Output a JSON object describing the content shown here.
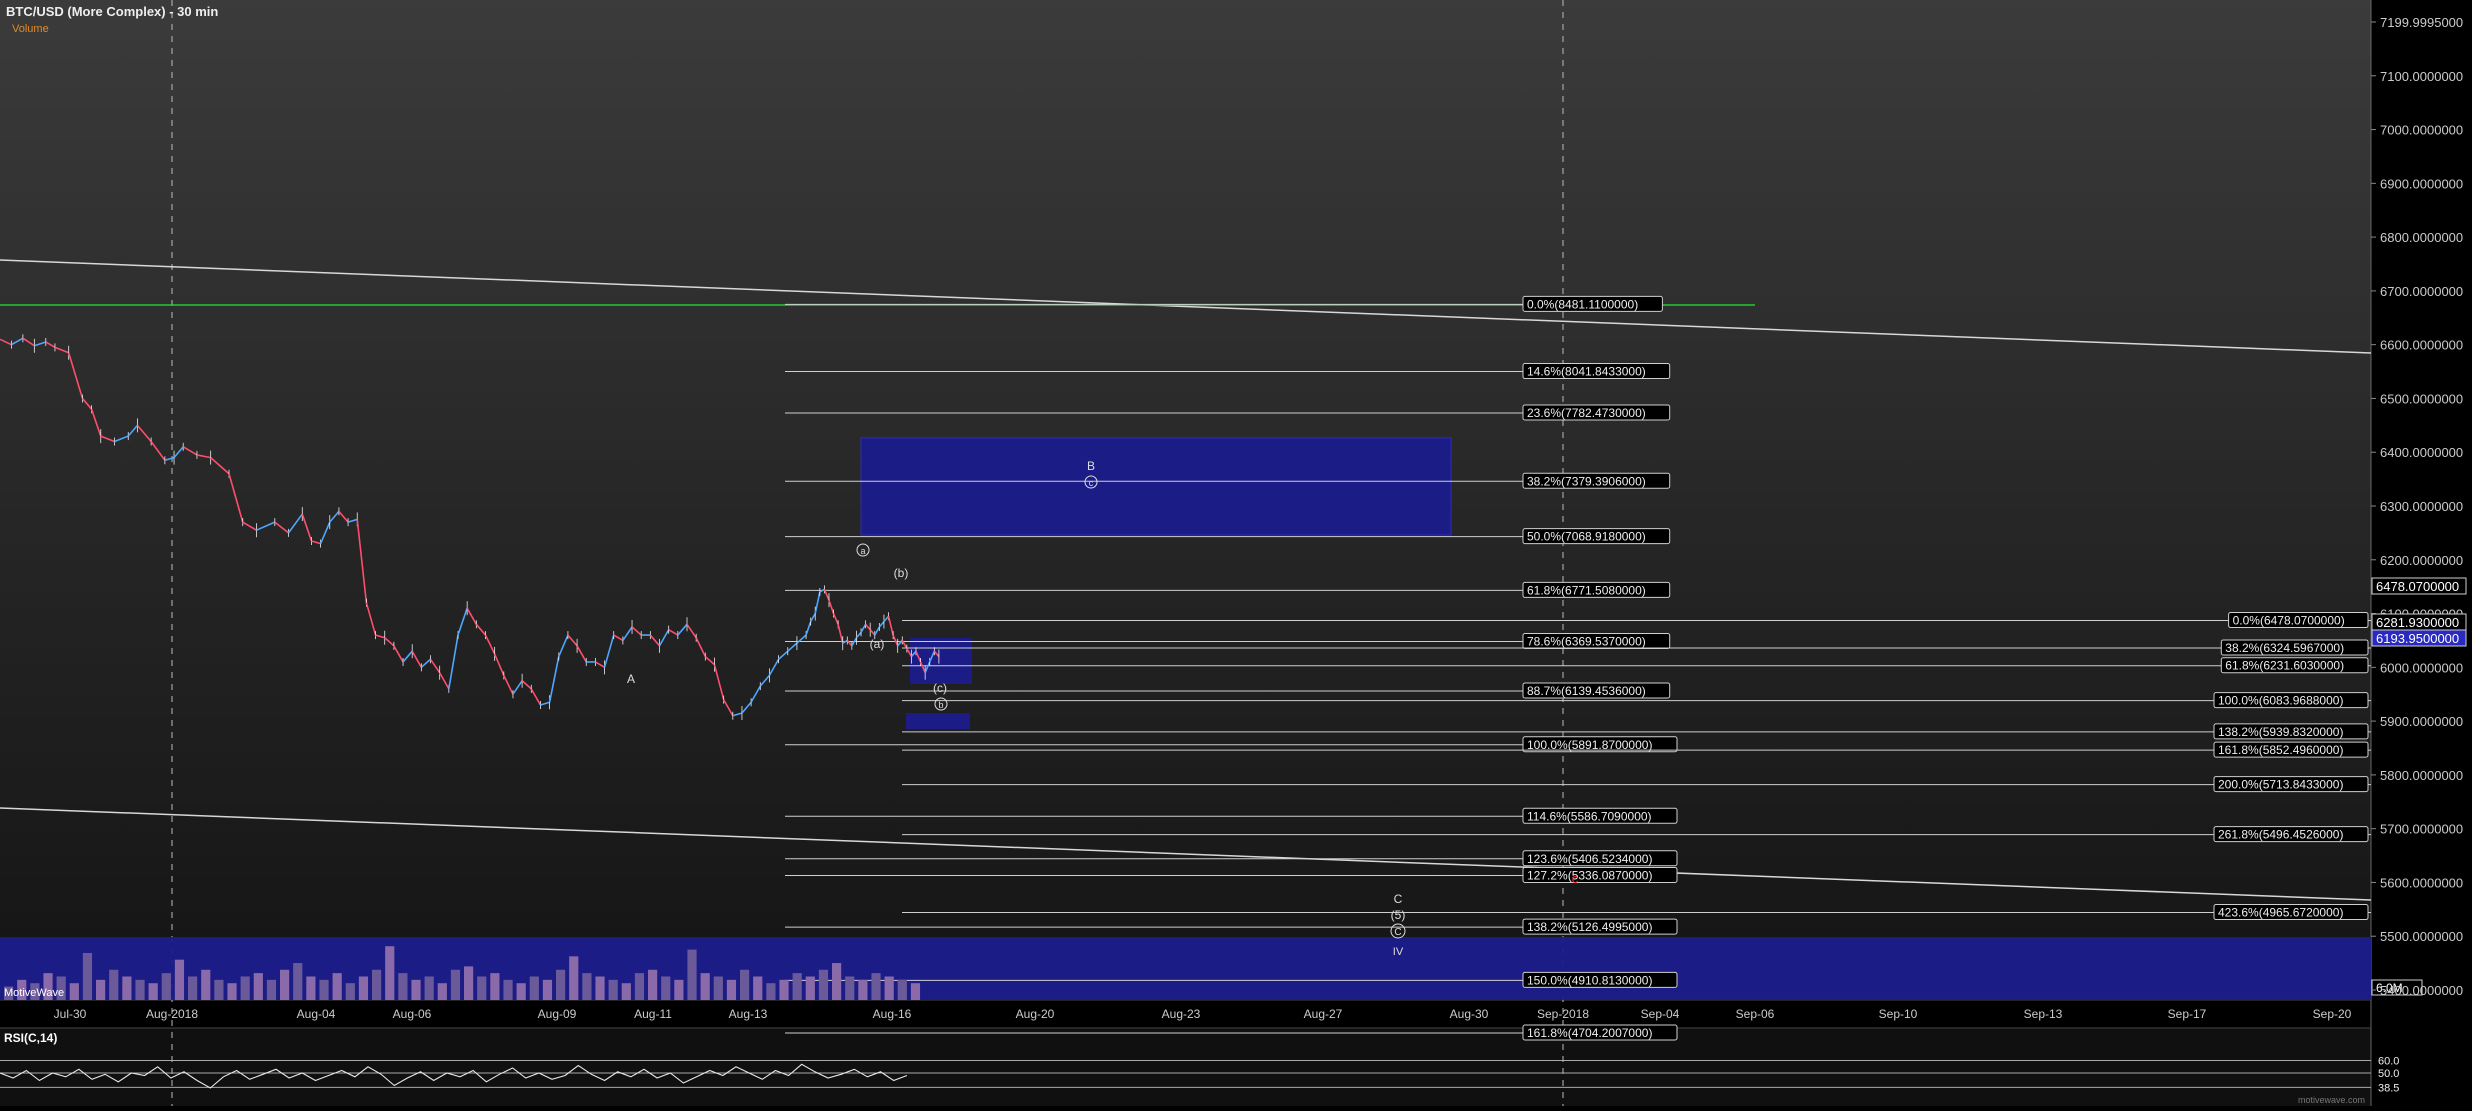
{
  "header": {
    "title": "BTC/USD (More Complex) - 30 min",
    "volume_label": "Volume",
    "rsi_label": "RSI(C,14)",
    "watermark": "MotiveWave",
    "credit": "motivewave.com"
  },
  "colors": {
    "background": "#000000",
    "up_candle": "#4da6ff",
    "down_candle": "#ff4d6d",
    "box_fill": "#1c1c8c",
    "green_line": "#22cc33",
    "wave_c_red": "#ff2222",
    "axis_text": "#cccccc"
  },
  "chart_data": [
    {
      "type": "line",
      "title": "BTC/USD (More Complex) - 30 min",
      "x_tick_labels": [
        "Jul-30",
        "Aug-2018",
        "Aug-04",
        "Aug-06",
        "Aug-09",
        "Aug-11",
        "Aug-13",
        "Aug-16",
        "Aug-20",
        "Aug-23",
        "Aug-27",
        "Aug-30",
        "Sep-2018",
        "Sep-04",
        "Sep-06",
        "Sep-10",
        "Sep-13",
        "Sep-17",
        "Sep-20"
      ],
      "y_tick_labels": [
        "7199.9995000",
        "7100.0000000",
        "7000.0000000",
        "6900.0000000",
        "6800.0000000",
        "6700.0000000",
        "6600.0000000",
        "6500.0000000",
        "6400.0000000",
        "6300.0000000",
        "6200.0000000",
        "6100.0000000",
        "6000.0000000",
        "5900.0000000",
        "5800.0000000",
        "5700.0000000",
        "5600.0000000",
        "5500.0000000",
        "5400.0000000"
      ],
      "ylim": [
        5380,
        7200
      ],
      "grid": false,
      "price_path": {
        "days": [
          0,
          0.25,
          0.5,
          0.75,
          1,
          1.2,
          1.5,
          1.8,
          2,
          2.2,
          2.5,
          2.8,
          3,
          3.3,
          3.6,
          3.8,
          4,
          4.3,
          4.6,
          5,
          5.3,
          5.6,
          6,
          6.3,
          6.6,
          6.8,
          7,
          7.2,
          7.4,
          7.6,
          7.8,
          8,
          8.2,
          8.4,
          8.6,
          8.8,
          9,
          9.2,
          9.4,
          9.6,
          9.8,
          10,
          10.2,
          10.4,
          10.6,
          10.8,
          11,
          11.2,
          11.4,
          11.6,
          11.8,
          12,
          12.2,
          12.4,
          12.6,
          12.8,
          13,
          13.2,
          13.4,
          13.6,
          13.8,
          14,
          14.2,
          14.4,
          14.6,
          14.8,
          15,
          15.2,
          15.4,
          15.6,
          15.8,
          16,
          16.2,
          16.4,
          16.6,
          16.8,
          17,
          17.2,
          17.4,
          17.6,
          17.7,
          17.8,
          17.9,
          18,
          18.1,
          18.2,
          18.3,
          18.4,
          18.5,
          18.6,
          18.7,
          18.8,
          18.9,
          19,
          19.1,
          19.2,
          19.3,
          19.4,
          19.5,
          19.6,
          19.7,
          19.8,
          19.9,
          20,
          20.1,
          20.2,
          20.3,
          20.4,
          20.5
        ],
        "prices": [
          6610,
          6600,
          6612,
          6598,
          6605,
          6595,
          6585,
          6500,
          6480,
          6430,
          6420,
          6430,
          6450,
          6420,
          6385,
          6390,
          6410,
          6395,
          6390,
          6360,
          6270,
          6255,
          6270,
          6250,
          6285,
          6235,
          6230,
          6270,
          6290,
          6270,
          6275,
          6120,
          6060,
          6055,
          6040,
          6010,
          6030,
          6000,
          6015,
          5990,
          5960,
          6060,
          6110,
          6080,
          6060,
          6025,
          5985,
          5950,
          5975,
          5960,
          5930,
          5935,
          6020,
          6060,
          6040,
          6010,
          6010,
          6000,
          6060,
          6050,
          6075,
          6060,
          6060,
          6040,
          6070,
          6060,
          6080,
          6055,
          6020,
          6005,
          5940,
          5910,
          5915,
          5935,
          5965,
          5985,
          6015,
          6030,
          6045,
          6060,
          6085,
          6100,
          6140,
          6145,
          6125,
          6100,
          6080,
          6045,
          6050,
          6040,
          6055,
          6065,
          6080,
          6070,
          6060,
          6075,
          6085,
          6095,
          6060,
          6040,
          6050,
          6035,
          6020,
          6030,
          6010,
          5990,
          6010,
          6030,
          6020,
          6005
        ]
      }
    },
    {
      "type": "bar",
      "title": "Volume",
      "ylim": [
        0,
        6
      ],
      "y_tick_labels": [
        "6.0M"
      ],
      "values": [
        0.4,
        0.6,
        0.5,
        0.8,
        0.7,
        0.5,
        1.4,
        0.6,
        0.9,
        0.7,
        0.6,
        0.5,
        0.8,
        1.2,
        0.7,
        0.9,
        0.6,
        0.5,
        0.7,
        0.8,
        0.6,
        0.9,
        1.1,
        0.7,
        0.6,
        0.8,
        0.5,
        0.7,
        0.9,
        1.6,
        0.8,
        0.6,
        0.7,
        0.5,
        0.9,
        1.0,
        0.7,
        0.8,
        0.6,
        0.5,
        0.7,
        0.6,
        0.9,
        1.3,
        0.8,
        0.7,
        0.6,
        0.5,
        0.8,
        0.9,
        0.7,
        0.6,
        1.5,
        0.8,
        0.7,
        0.6,
        0.9,
        0.7,
        0.5,
        0.6,
        0.8,
        0.7,
        0.9,
        1.1,
        0.7,
        0.6,
        0.8,
        0.7,
        0.6,
        0.5
      ]
    },
    {
      "type": "line",
      "title": "RSI(C,14)",
      "ylim": [
        30,
        70
      ],
      "y_tick_labels": [
        "60.0",
        "50.0",
        "38.5"
      ],
      "reference_levels": [
        60,
        50,
        38.5
      ],
      "values": [
        50,
        46,
        52,
        44,
        50,
        47,
        53,
        45,
        49,
        43,
        50,
        48,
        55,
        46,
        51,
        44,
        38,
        47,
        52,
        45,
        49,
        53,
        46,
        50,
        44,
        48,
        52,
        47,
        55,
        49,
        40,
        46,
        51,
        44,
        50,
        47,
        52,
        43,
        49,
        54,
        46,
        50,
        45,
        48,
        56,
        49,
        44,
        51,
        47,
        53,
        46,
        50,
        42,
        47,
        52,
        48,
        55,
        50,
        45,
        52,
        48,
        57,
        51,
        46,
        49,
        53,
        47,
        51,
        44,
        48
      ]
    }
  ],
  "fib_levels_left": [
    {
      "label": "0.0%(8481.1100000)",
      "price": 6675
    },
    {
      "label": "14.6%(8041.8433000)",
      "price": 6550
    },
    {
      "label": "23.6%(7782.4730000)",
      "price": 6473
    },
    {
      "label": "38.2%(7379.3906000)",
      "price": 6346
    },
    {
      "label": "50.0%(7068.9180000)",
      "price": 6243
    },
    {
      "label": "61.8%(6771.5080000)",
      "price": 6143
    },
    {
      "label": "78.6%(6369.5370000)",
      "price": 6048
    },
    {
      "label": "88.7%(6139.4536000)",
      "price": 5956
    },
    {
      "label": "100.0%(5891.8700000)",
      "price": 5856
    },
    {
      "label": "114.6%(5586.7090000)",
      "price": 5723
    },
    {
      "label": "123.6%(5406.5234000)",
      "price": 5644
    },
    {
      "label": "127.2%(5336.0870000)",
      "price": 5613
    },
    {
      "label": "138.2%(5126.4995000)",
      "price": 5517
    },
    {
      "label": "150.0%(4910.8130000)",
      "price": 5418
    },
    {
      "label": "161.8%(4704.2007000)",
      "price": 5320
    }
  ],
  "fib_levels_right": [
    {
      "label": "0.0%(6478.0700000)",
      "price": 6087
    },
    {
      "label": "38.2%(6324.5967000)",
      "price": 6036
    },
    {
      "label": "61.8%(6231.6030000)",
      "price": 6003
    },
    {
      "label": "100.0%(6083.9688000)",
      "price": 5938
    },
    {
      "label": "138.2%(5939.8320000)",
      "price": 5880
    },
    {
      "label": "161.8%(5852.4960000)",
      "price": 5846
    },
    {
      "label": "200.0%(5713.8433000)",
      "price": 5782
    },
    {
      "label": "261.8%(5496.4526000)",
      "price": 5689
    },
    {
      "label": "423.6%(4965.6720000)",
      "price": 5544
    }
  ],
  "price_badges": [
    "6478.0700000",
    "6281.9300000",
    "6193.9500000"
  ],
  "wave_labels": {
    "A": "A",
    "B": "B",
    "b_paren": "(b)",
    "a_paren": "(a)",
    "c_paren": "(c)",
    "circle_a": "a",
    "circle_b": "b",
    "circle_c": "c",
    "C_small": "C",
    "five": "(5)",
    "C_circle": "C",
    "IV": "IV",
    "c_red": "c"
  }
}
